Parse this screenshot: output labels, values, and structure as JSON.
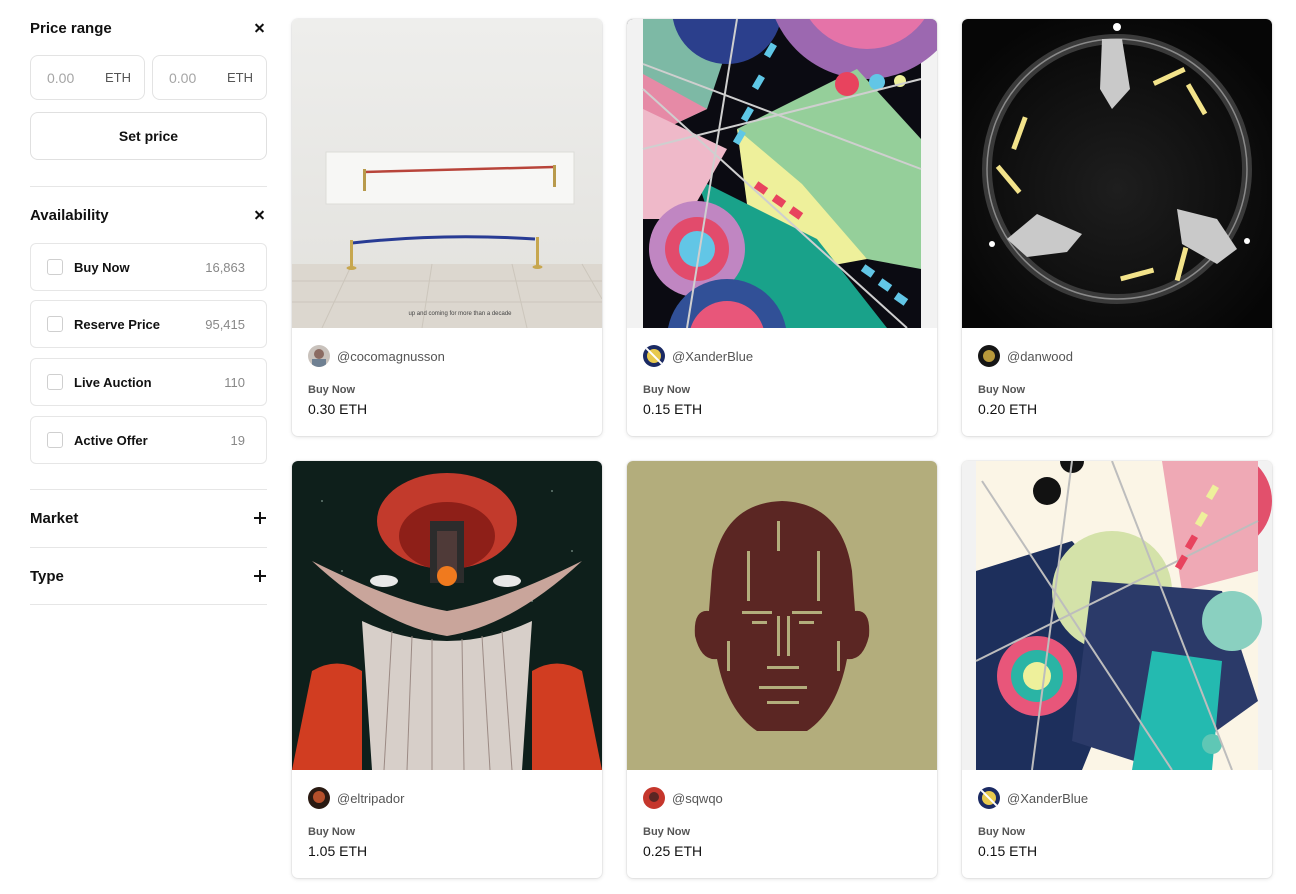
{
  "filters": {
    "price_range": {
      "title": "Price range",
      "min": {
        "placeholder": "0.00",
        "unit": "ETH"
      },
      "max": {
        "placeholder": "0.00",
        "unit": "ETH"
      },
      "set_price_label": "Set price"
    },
    "availability": {
      "title": "Availability",
      "options": [
        {
          "label": "Buy Now",
          "count": "16,863",
          "checked": false
        },
        {
          "label": "Reserve Price",
          "count": "95,415",
          "checked": false
        },
        {
          "label": "Live Auction",
          "count": "110",
          "checked": false
        },
        {
          "label": "Active Offer",
          "count": "19",
          "checked": false
        }
      ]
    },
    "market": {
      "title": "Market"
    },
    "type": {
      "title": "Type"
    }
  },
  "cards": [
    {
      "creator": "@cocomagnusson",
      "status": "Buy Now",
      "price": "0.30 ETH",
      "caption": "up and coming for more than a decade"
    },
    {
      "creator": "@XanderBlue",
      "status": "Buy Now",
      "price": "0.15 ETH"
    },
    {
      "creator": "@danwood",
      "status": "Buy Now",
      "price": "0.20 ETH"
    },
    {
      "creator": "@eltripador",
      "status": "Buy Now",
      "price": "1.05 ETH"
    },
    {
      "creator": "@sqwqo",
      "status": "Buy Now",
      "price": "0.25 ETH"
    },
    {
      "creator": "@XanderBlue",
      "status": "Buy Now",
      "price": "0.15 ETH"
    }
  ],
  "colors": {
    "border": "#e6e6e6",
    "text_primary": "#111111",
    "text_secondary": "#555555",
    "count": "#888888"
  }
}
